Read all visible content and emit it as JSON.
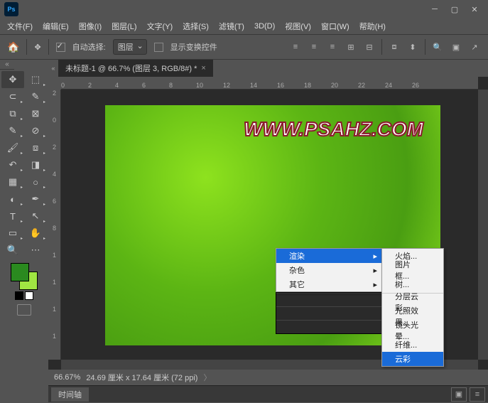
{
  "app": {
    "logo": "Ps"
  },
  "menubar": [
    "文件(F)",
    "编辑(E)",
    "图像(I)",
    "图层(L)",
    "文字(Y)",
    "选择(S)",
    "滤镜(T)",
    "3D(D)",
    "视图(V)",
    "窗口(W)",
    "帮助(H)"
  ],
  "optbar": {
    "autoSelectLabel": "自动选择:",
    "layerScope": "图层",
    "showTransform": "显示变换控件"
  },
  "docTab": "未标题-1 @ 66.7% (图层 3, RGB/8#) *",
  "rulerH": [
    "0",
    "2",
    "4",
    "6",
    "8",
    "10",
    "12",
    "14",
    "16",
    "18",
    "20",
    "22",
    "24",
    "26"
  ],
  "rulerV": [
    "2",
    "0",
    "2",
    "4",
    "6",
    "8",
    "1",
    "1",
    "1",
    "1"
  ],
  "canvasText": "WWW.PSAHZ.COM",
  "contextMenu1": [
    {
      "label": "渲染",
      "hl": true,
      "arrow": true
    },
    {
      "label": "杂色",
      "arrow": true
    },
    {
      "label": "其它",
      "arrow": true
    }
  ],
  "contextMenu2": [
    {
      "label": "火焰..."
    },
    {
      "label": "图片框..."
    },
    {
      "label": "树..."
    },
    {
      "sep": true
    },
    {
      "label": "分层云彩"
    },
    {
      "label": "光照效果..."
    },
    {
      "label": "镜头光晕..."
    },
    {
      "label": "纤维..."
    },
    {
      "label": "云彩",
      "hl": true
    }
  ],
  "status": {
    "zoom": "66.67%",
    "dims": "24.69 厘米 x 17.64 厘米 (72 ppi)"
  },
  "panelTab": "时间轴",
  "colors": {
    "fg": "#2a8a1f",
    "bg": "#a0e642"
  }
}
